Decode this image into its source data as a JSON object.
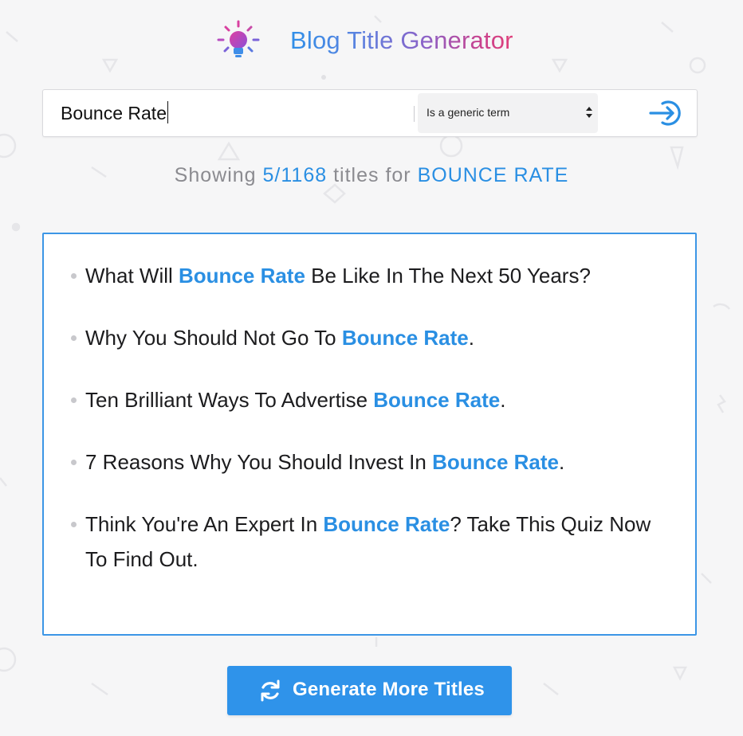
{
  "header": {
    "title": "Blog Title Generator",
    "icon": "lightbulb-icon"
  },
  "search": {
    "value": "Bounce Rate",
    "term_type": "Is a generic term",
    "submit_icon": "arrow-circle-right-icon"
  },
  "summary": {
    "prefix": "Showing",
    "count": "5/1168",
    "middle": "titles for",
    "keyword": "BOUNCE RATE"
  },
  "results": [
    {
      "before": "What Will ",
      "keyword": "Bounce Rate",
      "after": " Be Like In The Next 50 Years?"
    },
    {
      "before": "Why You Should Not Go To ",
      "keyword": "Bounce Rate",
      "after": "."
    },
    {
      "before": "Ten Brilliant Ways To Advertise ",
      "keyword": "Bounce Rate",
      "after": "."
    },
    {
      "before": "7 Reasons Why You Should Invest In ",
      "keyword": "Bounce Rate",
      "after": "."
    },
    {
      "before": "Think You're An Expert In ",
      "keyword": "Bounce Rate",
      "after": "? Take This Quiz Now To Find Out."
    }
  ],
  "generate_button": {
    "label": "Generate More Titles",
    "icon": "refresh-icon"
  },
  "colors": {
    "accent": "#2f93ea",
    "text": "#1c1c1e",
    "muted": "#8b8b90",
    "background": "#f6f6f7"
  }
}
